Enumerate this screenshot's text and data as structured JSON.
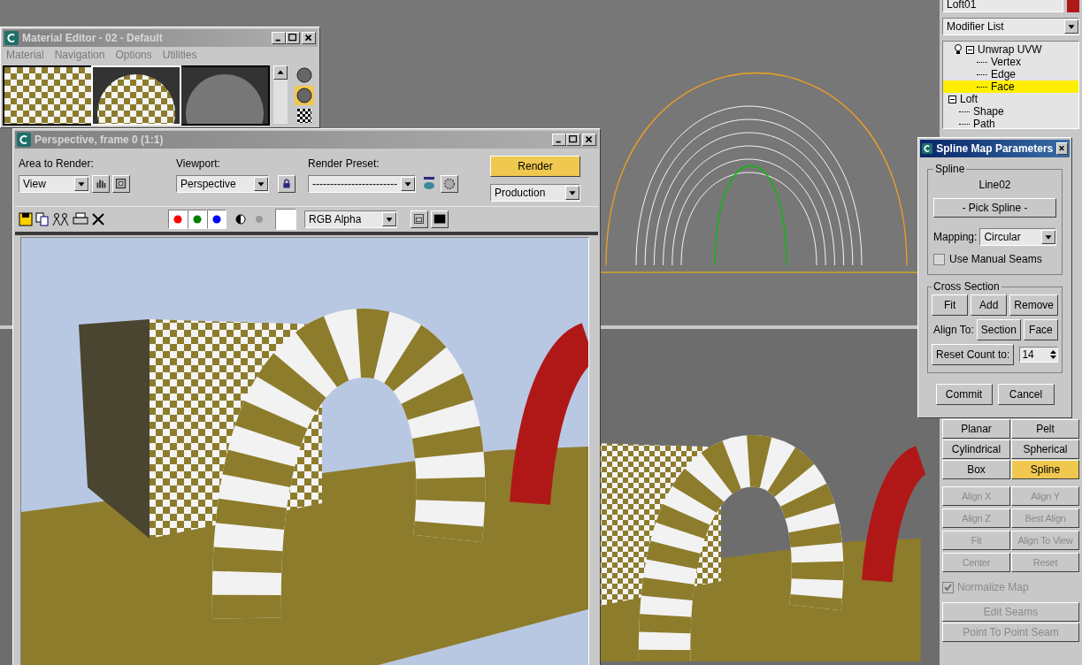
{
  "material_editor": {
    "title": "Material Editor - 02 - Default",
    "menu": [
      "Material",
      "Navigation",
      "Options",
      "Utilities"
    ],
    "slots": [
      {
        "kind": "checker",
        "selected": false
      },
      {
        "kind": "checker-sphere",
        "selected": true
      },
      {
        "kind": "sphere",
        "selected": false
      }
    ]
  },
  "render_window": {
    "title": "Perspective, frame 0 (1:1)",
    "area_label": "Area to Render:",
    "area_value": "View",
    "viewport_label": "Viewport:",
    "viewport_value": "Perspective",
    "preset_label": "Render Preset:",
    "preset_value": "------------------------",
    "render_button": "Render",
    "mode_value": "Production",
    "channels": [
      {
        "color": "#ff0000",
        "on": true
      },
      {
        "color": "#008000",
        "on": true
      },
      {
        "color": "#0000ff",
        "on": true
      }
    ],
    "display_value": "RGB Alpha"
  },
  "command_panel": {
    "object_name": "Loft01",
    "modifier_list": "Modifier List",
    "stack": [
      {
        "label": "Unwrap UVW",
        "expanded": true,
        "selected": false,
        "children": [
          {
            "label": "Vertex",
            "selected": false
          },
          {
            "label": "Edge",
            "selected": false
          },
          {
            "label": "Face",
            "selected": true
          }
        ]
      },
      {
        "label": "Loft",
        "expanded": true,
        "selected": false,
        "children": [
          {
            "label": "Shape",
            "selected": false
          },
          {
            "label": "Path",
            "selected": false
          }
        ]
      }
    ],
    "map_buttons": [
      {
        "label": "Planar",
        "selected": false
      },
      {
        "label": "Pelt",
        "selected": false
      },
      {
        "label": "Cylindrical",
        "selected": false
      },
      {
        "label": "Spherical",
        "selected": false
      },
      {
        "label": "Box",
        "selected": false
      },
      {
        "label": "Spline",
        "selected": true
      }
    ],
    "align_buttons": [
      {
        "label": "Align X",
        "disabled": true
      },
      {
        "label": "Align Y",
        "disabled": true
      },
      {
        "label": "Align Z",
        "disabled": true
      },
      {
        "label": "Best Align",
        "disabled": true
      },
      {
        "label": "Fit",
        "disabled": true
      },
      {
        "label": "Align To View",
        "disabled": true
      },
      {
        "label": "Center",
        "disabled": true
      },
      {
        "label": "Reset",
        "disabled": true
      }
    ],
    "normalize": {
      "label": "Normalize Map",
      "checked": true,
      "disabled": true
    },
    "seam_buttons": [
      {
        "label": "Edit Seams",
        "disabled": true
      },
      {
        "label": "Point To Point Seam",
        "disabled": true
      }
    ]
  },
  "spline_dialog": {
    "title": "Spline Map Parameters",
    "spline_group": "Spline",
    "spline_name": "Line02",
    "pick_button": "- Pick Spline -",
    "mapping_label": "Mapping:",
    "mapping_value": "Circular",
    "manual_seams": {
      "label": "Use Manual Seams",
      "checked": false
    },
    "cross_group": "Cross Section",
    "buttons": [
      "Fit",
      "Add",
      "Remove"
    ],
    "align_label": "Align To:",
    "align_buttons": [
      "Section",
      "Face"
    ],
    "reset_button": "Reset Count to:",
    "count": "14",
    "commit_button": "Commit",
    "cancel_button": "Cancel"
  }
}
